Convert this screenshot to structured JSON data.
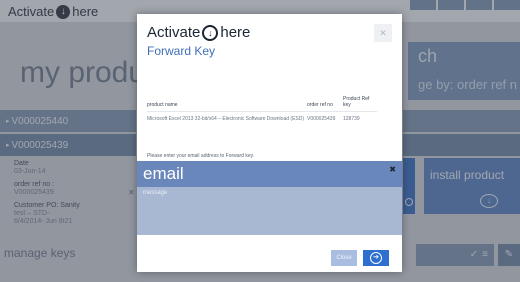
{
  "app": {
    "brand_prefix": "Activate",
    "brand_suffix": "here",
    "page_title": "my product",
    "search_label": "ch",
    "search_hint": "ge by: order ref n"
  },
  "product_rows": [
    {
      "label": "V000025440"
    },
    {
      "label": "V000025439"
    }
  ],
  "details": {
    "date_label": "Date",
    "date_value": "03-Jun-14",
    "order_ref_label": "order ref no :",
    "order_ref_value": "V000025439",
    "customer_po_label": "Customer PO: Sanity",
    "customer_po_value": "test – STD-",
    "customer_po_value2": "6/4/2014- Jun 8t21"
  },
  "tiles": {
    "install_label": "install product",
    "manage_keys_label": "manage keys"
  },
  "modal": {
    "brand_prefix": "Activate",
    "brand_suffix": "here",
    "subtitle": "Forward Key",
    "table": {
      "headers": [
        "product name",
        "order ref no",
        "Product Ref key"
      ],
      "rows": [
        [
          "Microsoft Excel 2013 32-bit/x64 – Electronic Software Download (ESD)",
          "V000025439",
          "128739"
        ]
      ]
    },
    "prompt": "Please enter your email address to Forward key.",
    "email_placeholder": "email",
    "message_placeholder": "message",
    "close_label": "Close"
  },
  "icons": {
    "brand": "download-circle-icon",
    "send": "arrow-right-circle-icon",
    "clear": "close-icon"
  },
  "colors": {
    "accent": "#2f6fd0",
    "email_field": "#6987ba",
    "message_field": "#a9b8d2",
    "subtitle": "#3f6eb9"
  }
}
